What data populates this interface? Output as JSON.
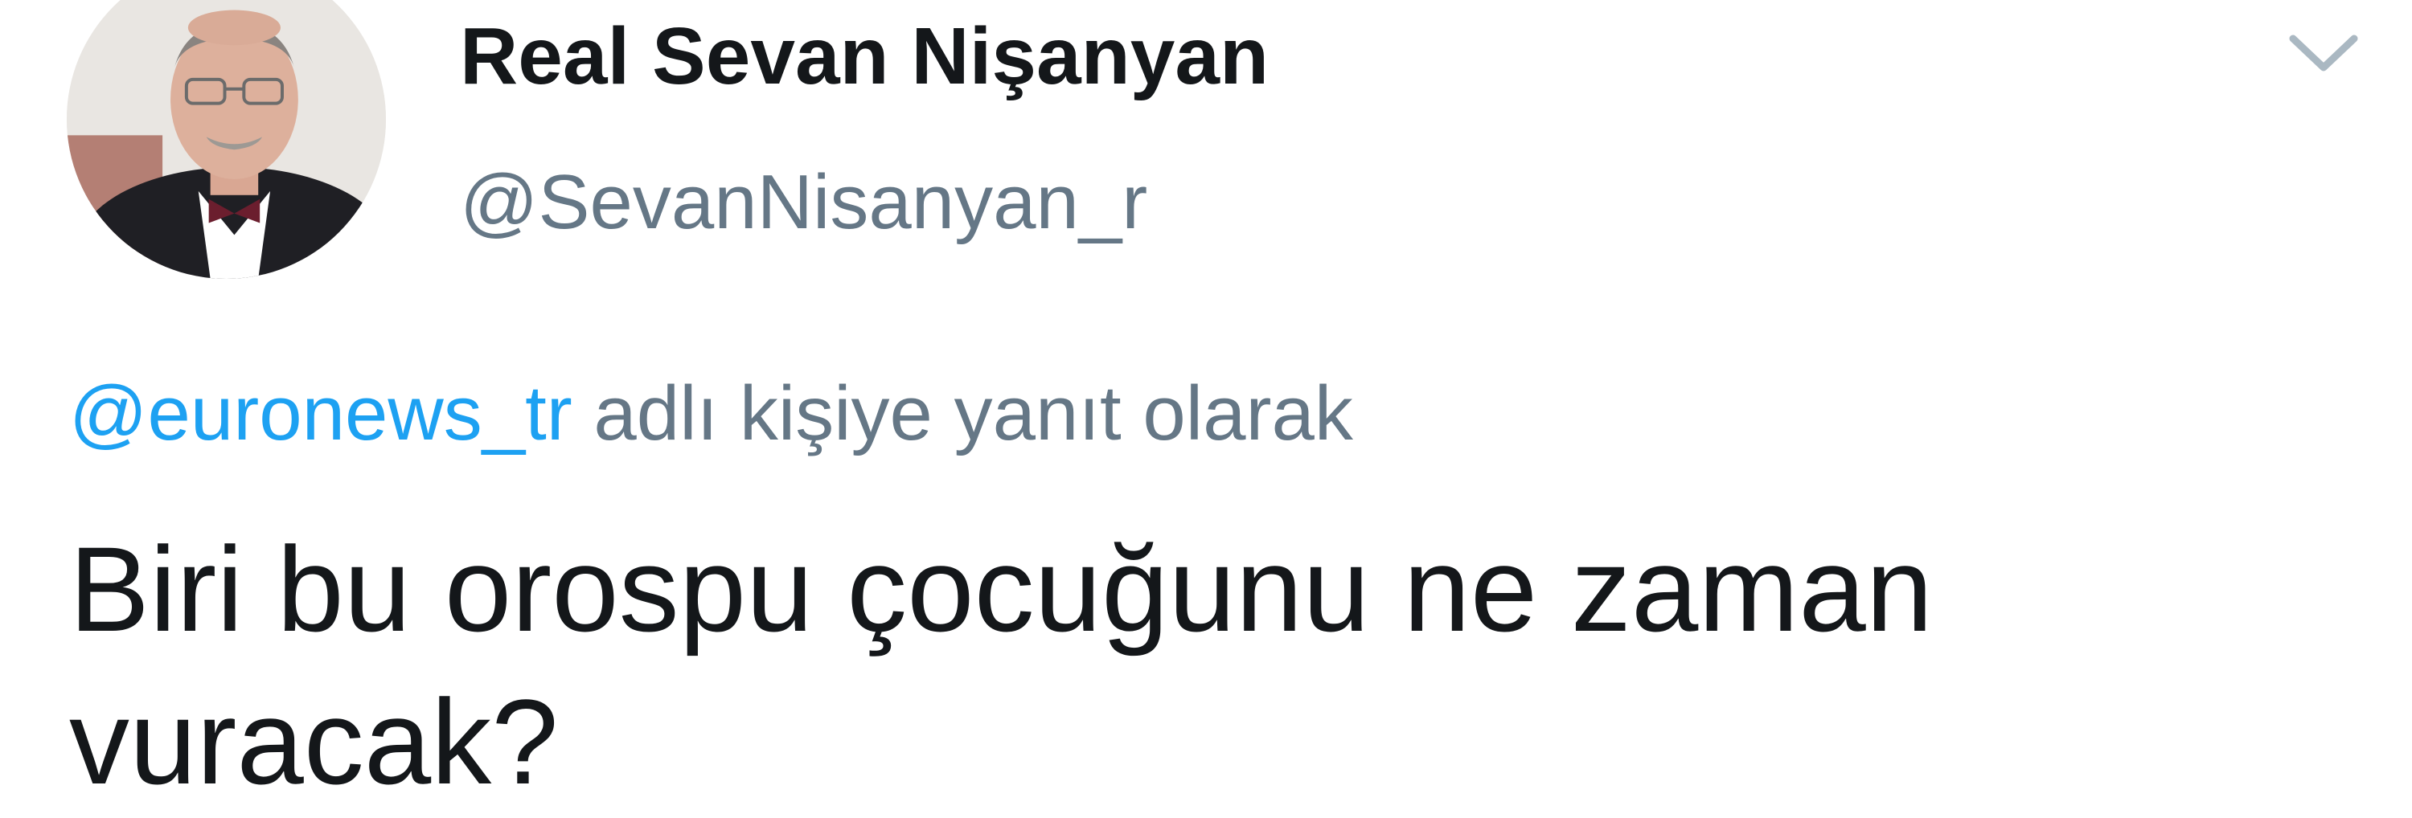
{
  "author": {
    "display_name": "Real Sevan Nişanyan",
    "handle": "@SevanNisanyan_r"
  },
  "reply": {
    "mention": "@euronews_tr",
    "suffix": "adlı kişiye yanıt olarak"
  },
  "tweet": {
    "text": "Biri bu orospu çocuğunu ne zaman\nvuracak?"
  },
  "icons": {
    "menu": "chevron-down-icon",
    "avatar": "profile-photo"
  },
  "colors": {
    "text": "#14171a",
    "secondary": "#657786",
    "link": "#1da1f2",
    "chevron": "#aab8c2"
  }
}
